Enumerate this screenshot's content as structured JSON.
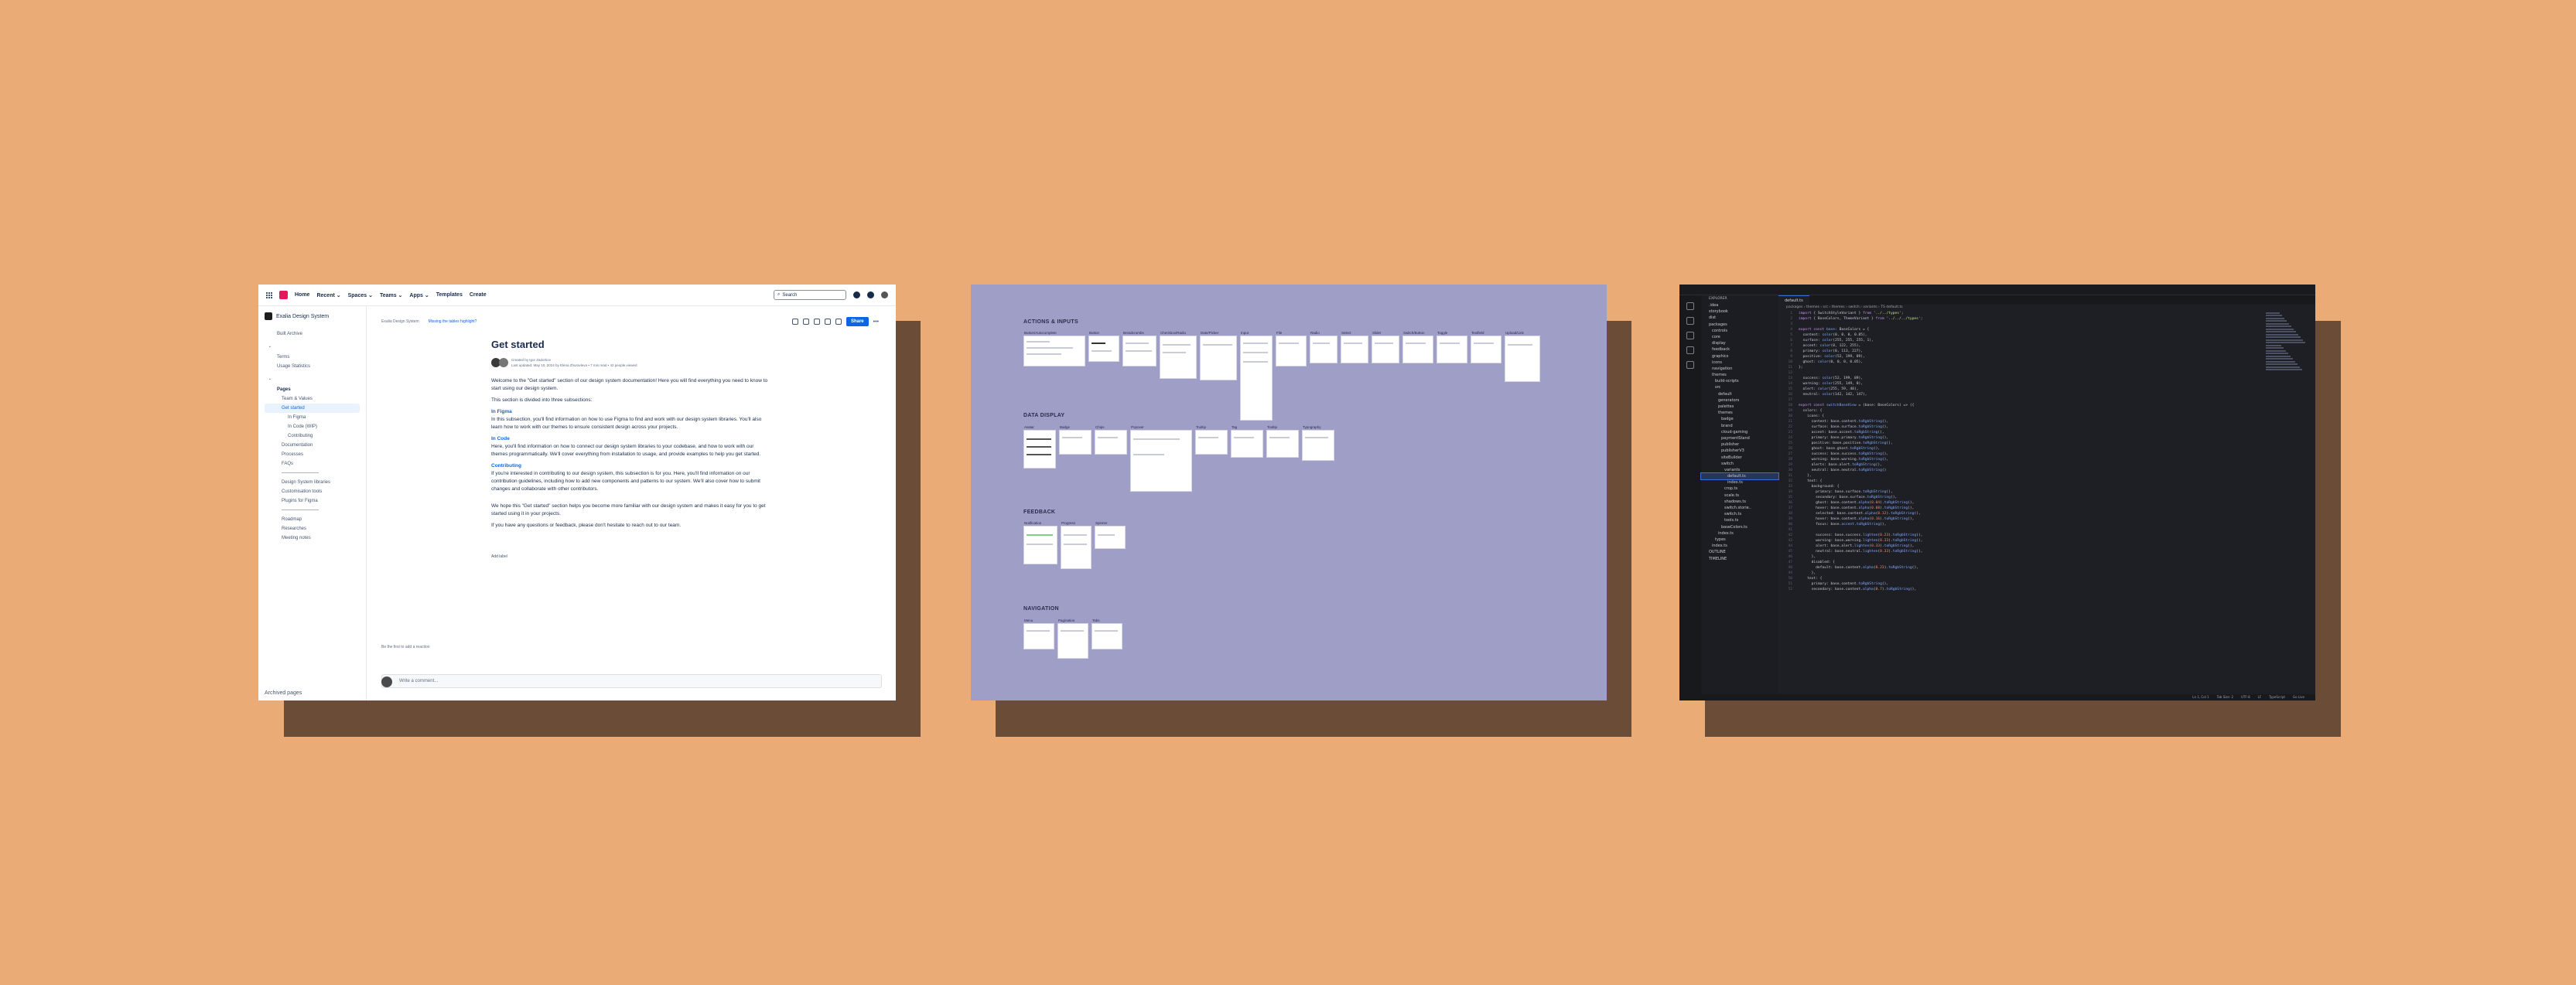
{
  "confluence": {
    "nav": [
      "Home",
      "Recent ⌄",
      "Spaces ⌄",
      "Teams ⌄",
      "Apps ⌄",
      "Templates"
    ],
    "create": "Create",
    "search_placeholder": "Search",
    "space_name": "Exalia Design System",
    "sidebar_items": [
      {
        "label": "Exalia Design System",
        "kind": "space"
      },
      {
        "label": "Built Archive",
        "kind": "item"
      },
      {
        "label": "Terms",
        "kind": "item"
      },
      {
        "label": "Usage Statistics",
        "kind": "item"
      },
      {
        "label": "Pages",
        "kind": "item"
      },
      {
        "label": "Team & Values",
        "kind": "ind1"
      },
      {
        "label": "Get started",
        "kind": "active"
      },
      {
        "label": "In Figma",
        "kind": "ind2"
      },
      {
        "label": "In Code (WIP)",
        "kind": "ind2"
      },
      {
        "label": "Contributing",
        "kind": "ind2"
      },
      {
        "label": "Documentation",
        "kind": "ind1"
      },
      {
        "label": "Processes",
        "kind": "ind1"
      },
      {
        "label": "FAQs",
        "kind": "ind1"
      },
      {
        "label": "Design System libraries",
        "kind": "ind1"
      },
      {
        "label": "Customisation tools",
        "kind": "ind1"
      },
      {
        "label": "Plugins for Figma",
        "kind": "ind1"
      },
      {
        "label": "Roadmap",
        "kind": "ind1"
      },
      {
        "label": "Researches",
        "kind": "ind1"
      },
      {
        "label": "Meeting notes",
        "kind": "ind1"
      }
    ],
    "archived": "Archived pages",
    "breadcrumb": "Exalia Design System",
    "banner_link": "Missing the tables highlight?",
    "share": "Share",
    "title": "Get started",
    "meta_line1": "Created by Igor Zadorkov",
    "meta_line2": "Last updated: May 10, 2024 by Elena Zhuravleva • 7 min read • 42 people viewed",
    "intro_1": "Welcome to the \"Get started\" section of our design system documentation! Here you will find everything you need to know to start using our design system.",
    "intro_2": "This section is divided into three subsections:",
    "h_figma": "In Figma",
    "p_figma": "In this subsection, you'll find information on how to use Figma to find and work with our design system libraries. You'll also learn how to work with our themes to ensure consistent design across your projects.",
    "h_code": "In Code",
    "p_code": "Here, you'll find information on how to connect our design system libraries to your codebase, and how to work with our themes programmatically. We'll cover everything from installation to usage, and provide examples to help you get started.",
    "h_contrib": "Contributing",
    "p_contrib": "If you're interested in contributing to our design system, this subsection is for you. Here, you'll find information on our contribution guidelines, including how to add new components and patterns to our system. We'll also cover how to submit changes and collaborate with other contributors.",
    "outro_1": "We hope this \"Get started\" section helps you become more familiar with our design system and makes it easy for you to get started using it in your projects.",
    "outro_2": "If you have any questions or feedback, please don't hesitate to reach out to our team.",
    "add_label": "Add label",
    "like_text": "Be the first to add a reaction",
    "comment_placeholder": "Write a comment..."
  },
  "figma": {
    "sections": [
      "ACTIONS & INPUTS",
      "DATA DISPLAY",
      "FEEDBACK",
      "NAVIGATION"
    ],
    "actions_frames": [
      "Button/Autocomplete",
      "Button",
      "Breadcrumbs",
      "Checkbox/Radio",
      "Date/Picker",
      "Input",
      "File",
      "Radio",
      "Select",
      "Slider",
      "Switch/Button",
      "Toggle",
      "Textfield",
      "Upload/Link"
    ],
    "display_frames": [
      "Avatar",
      "Badge",
      "Chips",
      "Popover",
      "Tooltip",
      "Tag",
      "Tooltip",
      "Typography"
    ],
    "feedback_frames": [
      "Notification",
      "Progress",
      "Spinner"
    ],
    "navigation_frames": [
      "Menu",
      "Pagination",
      "Tabs"
    ]
  },
  "vscode": {
    "explorer_title": "EXPLORER",
    "tab": "default.ts",
    "breadcrumb": "packages › themes › src › themes › switch › variants › TS default.ts",
    "tree": [
      ".idea",
      "storybook",
      "dist",
      "packages",
      "controls",
      "core",
      "display",
      "feedback",
      "graphics",
      "icons",
      "navigation",
      "themes",
      "build-scripts",
      "src",
      "default",
      "generators",
      "palettes",
      "themes",
      "badge",
      "brand",
      "cloud-gaming",
      "paymentStand",
      "publisher",
      "publisherV3",
      "siteBuilder",
      "switch",
      "variants",
      "default.ts",
      "index.ts",
      "crop.ts",
      "scale.ts",
      "shadows.ts",
      "switch.storie..",
      "switch.ts",
      "tools.ts",
      "baseColors.ts",
      "index.ts",
      "types",
      "index.ts",
      "OUTLINE",
      "TIMELINE"
    ],
    "selected_index": 27,
    "code": [
      [
        [
          "kw",
          "import "
        ],
        [
          "pl",
          "{ SwitchStyleVariant } "
        ],
        [
          "kw",
          "from "
        ],
        [
          "st",
          "'../../types'"
        ],
        [
          "pl",
          ";"
        ]
      ],
      [
        [
          "kw",
          "import "
        ],
        [
          "pl",
          "{ BaseColors, ThemeVariant } "
        ],
        [
          "kw",
          "from "
        ],
        [
          "st",
          "'../../../types'"
        ],
        [
          "pl",
          ";"
        ]
      ],
      [],
      [
        [
          "kw",
          "export const "
        ],
        [
          "fn",
          "base"
        ],
        [
          "pl",
          ": BaseColors = {"
        ]
      ],
      [
        [
          "pl",
          "  content: "
        ],
        [
          "fn",
          "color"
        ],
        [
          "pl",
          "(0, 0, 0, 0.85),"
        ]
      ],
      [
        [
          "pl",
          "  surface: "
        ],
        [
          "fn",
          "color"
        ],
        [
          "pl",
          "(255, 255, 255, 1),"
        ]
      ],
      [
        [
          "pl",
          "  accent: "
        ],
        [
          "fn",
          "color"
        ],
        [
          "pl",
          "(0, 122, 255),"
        ]
      ],
      [
        [
          "pl",
          "  primary: "
        ],
        [
          "fn",
          "color"
        ],
        [
          "pl",
          "(0, 113, 227),"
        ]
      ],
      [
        [
          "pl",
          "  positive: "
        ],
        [
          "fn",
          "color"
        ],
        [
          "pl",
          "(52, 199, 89),"
        ]
      ],
      [
        [
          "pl",
          "  ghost: "
        ],
        [
          "fn",
          "color"
        ],
        [
          "pl",
          "(0, 0, 0, 0.05),"
        ]
      ],
      [
        [
          "pl",
          "};"
        ]
      ],
      [],
      [
        [
          "pl",
          "  success: "
        ],
        [
          "fn",
          "color"
        ],
        [
          "pl",
          "(52, 199, 89),"
        ]
      ],
      [
        [
          "pl",
          "  warning: "
        ],
        [
          "fn",
          "color"
        ],
        [
          "pl",
          "(255, 149, 0),"
        ]
      ],
      [
        [
          "pl",
          "  alert: "
        ],
        [
          "fn",
          "color"
        ],
        [
          "pl",
          "(255, 59, 48),"
        ]
      ],
      [
        [
          "pl",
          "  neutral: "
        ],
        [
          "fn",
          "color"
        ],
        [
          "pl",
          "(142, 142, 147),"
        ]
      ],
      [],
      [
        [
          "kw",
          "export const "
        ],
        [
          "fn",
          "switchBaseView"
        ],
        [
          "pl",
          " = (base: BaseColors) => ({"
        ]
      ],
      [
        [
          "pl",
          "  colors: {"
        ]
      ],
      [
        [
          "pl",
          "    icons: {"
        ]
      ],
      [
        [
          "pl",
          "      content: base.content."
        ],
        [
          "fn",
          "toRgbString"
        ],
        [
          "pl",
          "(),"
        ]
      ],
      [
        [
          "pl",
          "      surface: base.surface."
        ],
        [
          "fn",
          "toRgbString"
        ],
        [
          "pl",
          "(),"
        ]
      ],
      [
        [
          "pl",
          "      accent: base.accent."
        ],
        [
          "fn",
          "toRgbString"
        ],
        [
          "pl",
          "(),"
        ]
      ],
      [
        [
          "pl",
          "      primary: base.primary."
        ],
        [
          "fn",
          "toRgbString"
        ],
        [
          "pl",
          "(),"
        ]
      ],
      [
        [
          "pl",
          "      positive: base.positive."
        ],
        [
          "fn",
          "toRgbString"
        ],
        [
          "pl",
          "(),"
        ]
      ],
      [
        [
          "pl",
          "      ghost: base.ghost."
        ],
        [
          "fn",
          "toRgbString"
        ],
        [
          "pl",
          "(),"
        ]
      ],
      [
        [
          "pl",
          "      success: base.success."
        ],
        [
          "fn",
          "toRgbString"
        ],
        [
          "pl",
          "(),"
        ]
      ],
      [
        [
          "pl",
          "      warning: base.warning."
        ],
        [
          "fn",
          "toRgbString"
        ],
        [
          "pl",
          "(),"
        ]
      ],
      [
        [
          "pl",
          "      alerts: base.alert."
        ],
        [
          "fn",
          "toRgbString"
        ],
        [
          "pl",
          "(),"
        ]
      ],
      [
        [
          "pl",
          "      neutral: base.neutral."
        ],
        [
          "fn",
          "toRgbString"
        ],
        [
          "pl",
          "()"
        ]
      ],
      [
        [
          "pl",
          "    },"
        ]
      ],
      [
        [
          "pl",
          "    text: {"
        ]
      ],
      [
        [
          "pl",
          "      background: {"
        ]
      ],
      [
        [
          "pl",
          "        primary: base.surface."
        ],
        [
          "fn",
          "toRgbString"
        ],
        [
          "pl",
          "(),"
        ]
      ],
      [
        [
          "pl",
          "        secondary: base.surface."
        ],
        [
          "fn",
          "toRgbString"
        ],
        [
          "pl",
          "(),"
        ]
      ],
      [
        [
          "pl",
          "        ghost: base.content."
        ],
        [
          "fn",
          "alpha"
        ],
        [
          "pl",
          "("
        ],
        [
          "pr",
          "0.04"
        ],
        [
          "pl",
          ")."
        ],
        [
          "fn",
          "toRgbString"
        ],
        [
          "pl",
          "(),"
        ]
      ],
      [
        [
          "pl",
          "        hover: base.content."
        ],
        [
          "fn",
          "alpha"
        ],
        [
          "pl",
          "("
        ],
        [
          "pr",
          "0.08"
        ],
        [
          "pl",
          ")."
        ],
        [
          "fn",
          "toRgbString"
        ],
        [
          "pl",
          "(),"
        ]
      ],
      [
        [
          "pl",
          "        selected: base.content."
        ],
        [
          "fn",
          "alpha"
        ],
        [
          "pl",
          "("
        ],
        [
          "pr",
          "0.12"
        ],
        [
          "pl",
          ")."
        ],
        [
          "fn",
          "toRgbString"
        ],
        [
          "pl",
          "(),"
        ]
      ],
      [
        [
          "pl",
          "        hover: base.content."
        ],
        [
          "fn",
          "alpha"
        ],
        [
          "pl",
          "("
        ],
        [
          "pr",
          "0.16"
        ],
        [
          "pl",
          ")."
        ],
        [
          "fn",
          "toRgbString"
        ],
        [
          "pl",
          "(),"
        ]
      ],
      [
        [
          "pl",
          "        focus: base."
        ],
        [
          "fn",
          "accent"
        ],
        [
          "pl",
          "."
        ],
        [
          "fn",
          "toRgbString"
        ],
        [
          "pl",
          "(),"
        ]
      ],
      [],
      [
        [
          "pl",
          "        success: base.success."
        ],
        [
          "fn",
          "lighten"
        ],
        [
          "pl",
          "("
        ],
        [
          "pr",
          "0.23"
        ],
        [
          "pl",
          ")."
        ],
        [
          "fn",
          "toRgbString"
        ],
        [
          "pl",
          "(),"
        ]
      ],
      [
        [
          "pl",
          "        warning: base.warning."
        ],
        [
          "fn",
          "lighten"
        ],
        [
          "pl",
          "("
        ],
        [
          "pr",
          "0.33"
        ],
        [
          "pl",
          ")."
        ],
        [
          "fn",
          "toRgbString"
        ],
        [
          "pl",
          "(),"
        ]
      ],
      [
        [
          "pl",
          "        alert: base.alert."
        ],
        [
          "fn",
          "lighten"
        ],
        [
          "pl",
          "("
        ],
        [
          "pr",
          "0.33"
        ],
        [
          "pl",
          ")."
        ],
        [
          "fn",
          "toRgbString"
        ],
        [
          "pl",
          "(),"
        ]
      ],
      [
        [
          "pl",
          "        neutral: base.neutral."
        ],
        [
          "fn",
          "lighten"
        ],
        [
          "pl",
          "("
        ],
        [
          "pr",
          "0.33"
        ],
        [
          "pl",
          ")."
        ],
        [
          "fn",
          "toRgbString"
        ],
        [
          "pl",
          "(),"
        ]
      ],
      [
        [
          "pl",
          "      },"
        ]
      ],
      [
        [
          "pl",
          "      disabled: {"
        ]
      ],
      [
        [
          "pl",
          "        default: base.content."
        ],
        [
          "fn",
          "alpha"
        ],
        [
          "pl",
          "("
        ],
        [
          "pr",
          "0.23"
        ],
        [
          "pl",
          ")."
        ],
        [
          "fn",
          "toRgbString"
        ],
        [
          "pl",
          "(),"
        ]
      ],
      [
        [
          "pl",
          "      },"
        ]
      ],
      [
        [
          "pl",
          "    text: {"
        ]
      ],
      [
        [
          "pl",
          "      primary: base.content."
        ],
        [
          "fn",
          "toRgbString"
        ],
        [
          "pl",
          "(),"
        ]
      ],
      [
        [
          "pl",
          "      secondary: base.content."
        ],
        [
          "fn",
          "alpha"
        ],
        [
          "pl",
          "("
        ],
        [
          "pr",
          "0.7"
        ],
        [
          "pl",
          ")."
        ],
        [
          "fn",
          "toRgbString"
        ],
        [
          "pl",
          "(),"
        ]
      ]
    ],
    "status": [
      "Ln 1, Col 1",
      "Tab Size: 2",
      "UTF-8",
      "LF",
      "TypeScript",
      "Go Live"
    ]
  }
}
